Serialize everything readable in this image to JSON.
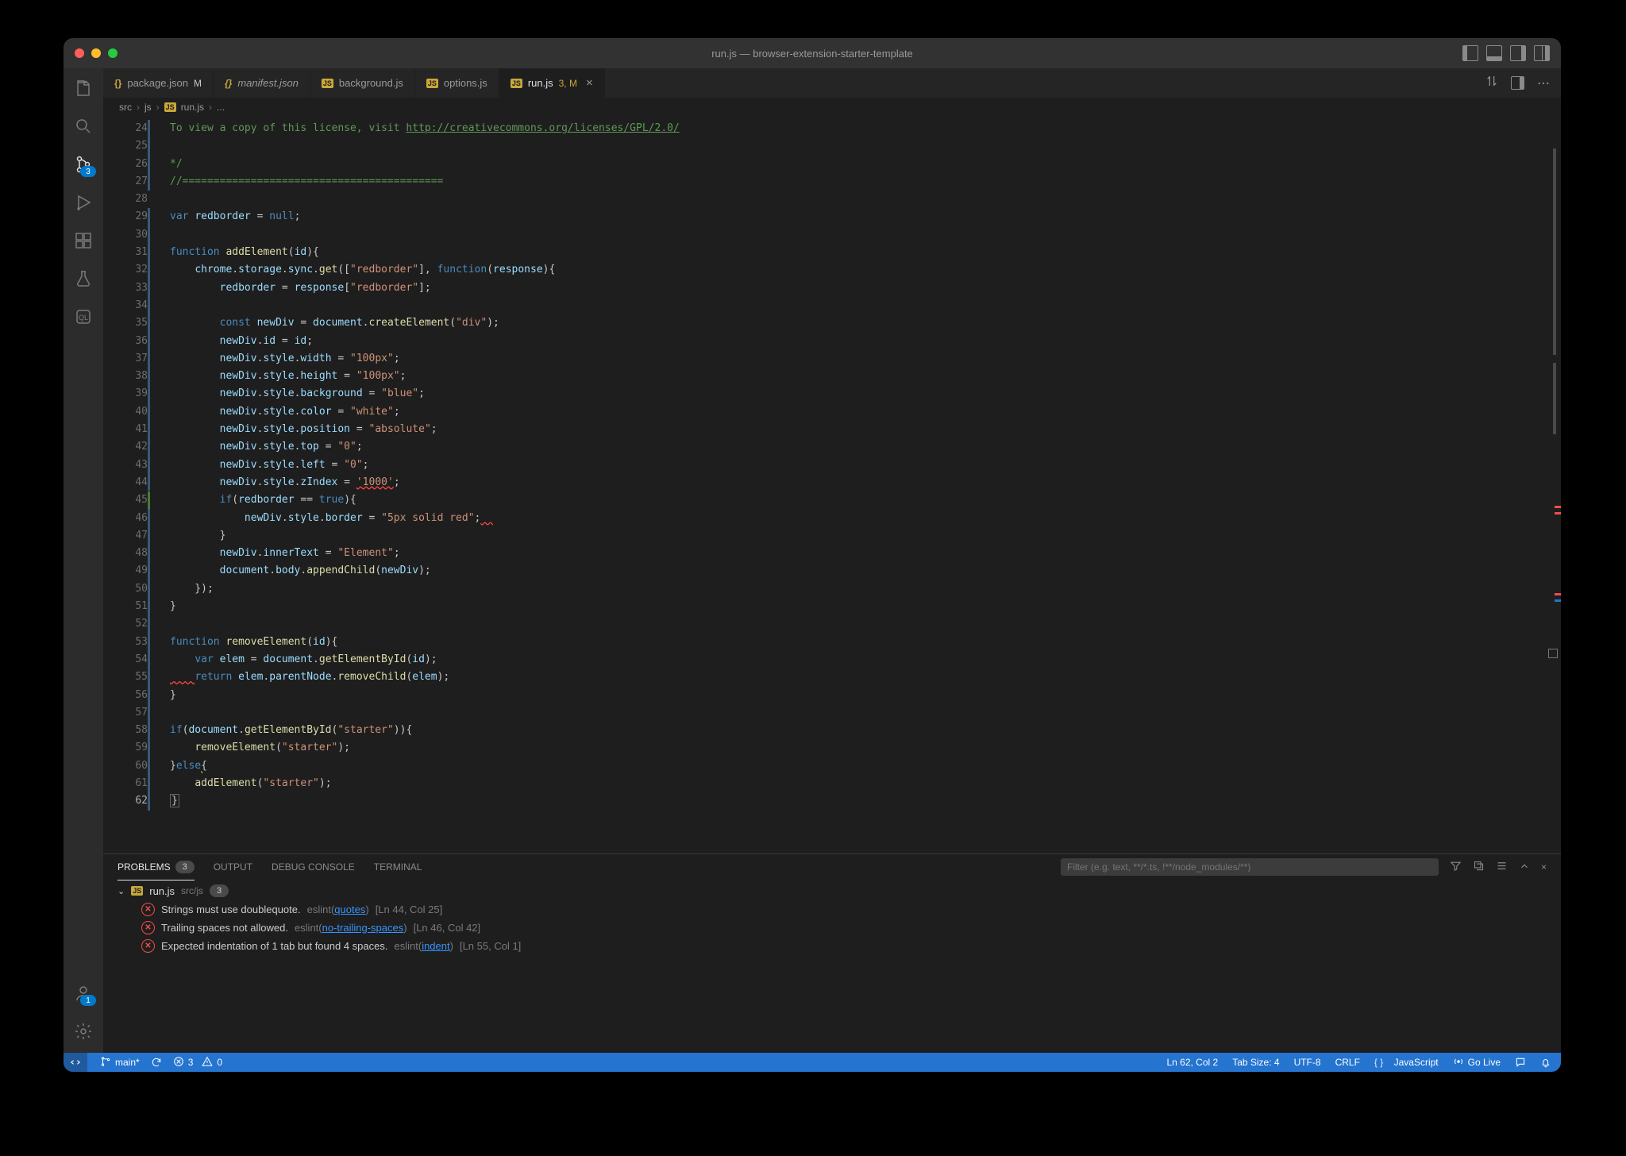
{
  "window": {
    "title": "run.js — browser-extension-starter-template"
  },
  "tabs": [
    {
      "icon": "json",
      "label": "package.json",
      "suffix": "M",
      "italic": false
    },
    {
      "icon": "json",
      "label": "manifest.json",
      "suffix": "",
      "italic": true
    },
    {
      "icon": "js",
      "label": "background.js",
      "suffix": "",
      "italic": false
    },
    {
      "icon": "js",
      "label": "options.js",
      "suffix": "",
      "italic": false
    },
    {
      "icon": "js",
      "label": "run.js",
      "suffix": "3, M",
      "italic": false,
      "active": true,
      "close": true
    }
  ],
  "breadcrumb": {
    "parts": [
      "src",
      "js",
      "run.js"
    ],
    "tail": "..."
  },
  "editor": {
    "first_line": 24,
    "active_line": 62,
    "lines": [
      {
        "n": 24,
        "html": "<span class='c-com'>To view a copy of this license, visit <span class='underline'>http://creativecommons.org/licenses/GPL/2.0/</span></span>"
      },
      {
        "n": 25,
        "html": ""
      },
      {
        "n": 26,
        "html": "<span class='c-com'>*/</span>"
      },
      {
        "n": 27,
        "html": "<span class='c-com'>//==========================================</span>"
      },
      {
        "n": 28,
        "html": ""
      },
      {
        "n": 29,
        "html": "<span class='c-key'>var</span> <span class='c-var'>redborder</span> = <span class='c-bool'>null</span>;"
      },
      {
        "n": 30,
        "html": ""
      },
      {
        "n": 31,
        "html": "<span class='c-key'>function</span> <span class='c-fn'>addElement</span>(<span class='c-var'>id</span>){"
      },
      {
        "n": 32,
        "html": "    <span class='c-var'>chrome</span>.<span class='c-var'>storage</span>.<span class='c-var'>sync</span>.<span class='c-fn'>get</span>([<span class='c-str'>\"redborder\"</span>], <span class='c-key'>function</span>(<span class='c-var'>response</span>){"
      },
      {
        "n": 33,
        "html": "        <span class='c-var'>redborder</span> = <span class='c-var'>response</span>[<span class='c-str'>\"redborder\"</span>];"
      },
      {
        "n": 34,
        "html": ""
      },
      {
        "n": 35,
        "html": "        <span class='c-key'>const</span> <span class='c-var'>newDiv</span> = <span class='c-var'>document</span>.<span class='c-fn'>createElement</span>(<span class='c-str'>\"div\"</span>);"
      },
      {
        "n": 36,
        "html": "        <span class='c-var'>newDiv</span>.<span class='c-var'>id</span> = <span class='c-var'>id</span>;"
      },
      {
        "n": 37,
        "html": "        <span class='c-var'>newDiv</span>.<span class='c-var'>style</span>.<span class='c-var'>width</span> = <span class='c-str'>\"100px\"</span>;"
      },
      {
        "n": 38,
        "html": "        <span class='c-var'>newDiv</span>.<span class='c-var'>style</span>.<span class='c-var'>height</span> = <span class='c-str'>\"100px\"</span>;"
      },
      {
        "n": 39,
        "html": "        <span class='c-var'>newDiv</span>.<span class='c-var'>style</span>.<span class='c-var'>background</span> = <span class='c-str'>\"blue\"</span>;"
      },
      {
        "n": 40,
        "html": "        <span class='c-var'>newDiv</span>.<span class='c-var'>style</span>.<span class='c-var'>color</span> = <span class='c-str'>\"white\"</span>;"
      },
      {
        "n": 41,
        "html": "        <span class='c-var'>newDiv</span>.<span class='c-var'>style</span>.<span class='c-var'>position</span> = <span class='c-str'>\"absolute\"</span>;"
      },
      {
        "n": 42,
        "html": "        <span class='c-var'>newDiv</span>.<span class='c-var'>style</span>.<span class='c-var'>top</span> = <span class='c-str'>\"0\"</span>;"
      },
      {
        "n": 43,
        "html": "        <span class='c-var'>newDiv</span>.<span class='c-var'>style</span>.<span class='c-var'>left</span> = <span class='c-str'>\"0\"</span>;"
      },
      {
        "n": 44,
        "html": "        <span class='c-var'>newDiv</span>.<span class='c-var'>style</span>.<span class='c-var'>zIndex</span> = <span class='c-str squiggle'>'1000'</span>;"
      },
      {
        "n": 45,
        "html": "        <span class='c-key'>if</span>(<span class='c-var'>redborder</span> == <span class='c-bool'>true</span>){"
      },
      {
        "n": 46,
        "html": "            <span class='c-var'>newDiv</span>.<span class='c-var'>style</span>.<span class='c-var'>border</span> = <span class='c-str'>\"5px solid red\"</span>;<span class='squiggle'>  </span>"
      },
      {
        "n": 47,
        "html": "        }"
      },
      {
        "n": 48,
        "html": "        <span class='c-var'>newDiv</span>.<span class='c-var'>innerText</span> = <span class='c-str'>\"Element\"</span>;"
      },
      {
        "n": 49,
        "html": "        <span class='c-var'>document</span>.<span class='c-var'>body</span>.<span class='c-fn'>appendChild</span>(<span class='c-var'>newDiv</span>);"
      },
      {
        "n": 50,
        "html": "    });"
      },
      {
        "n": 51,
        "html": "}"
      },
      {
        "n": 52,
        "html": ""
      },
      {
        "n": 53,
        "html": "<span class='c-key'>function</span> <span class='c-fn'>removeElement</span>(<span class='c-var'>id</span>){"
      },
      {
        "n": 54,
        "html": "    <span class='c-key'>var</span> <span class='c-var'>elem</span> = <span class='c-var'>document</span>.<span class='c-fn'>getElementById</span>(<span class='c-var'>id</span>);"
      },
      {
        "n": 55,
        "html": "<span class='squiggle'>    </span><span class='c-key'>return</span> <span class='c-var'>elem</span>.<span class='c-var'>parentNode</span>.<span class='c-fn'>removeChild</span>(<span class='c-var'>elem</span>);"
      },
      {
        "n": 56,
        "html": "}"
      },
      {
        "n": 57,
        "html": ""
      },
      {
        "n": 58,
        "html": "<span class='c-key'>if</span>(<span class='c-var'>document</span>.<span class='c-fn'>getElementById</span>(<span class='c-str'>\"starter\"</span>)){"
      },
      {
        "n": 59,
        "html": "    <span class='c-fn'>removeElement</span>(<span class='c-str'>\"starter\"</span>);"
      },
      {
        "n": 60,
        "html": "}<span class='c-key'>else</span><span class='squiggle-y'>{</span>"
      },
      {
        "n": 61,
        "html": "    <span class='c-fn'>addElement</span>(<span class='c-str'>\"starter\"</span>);"
      },
      {
        "n": 62,
        "html": "<span style='border:1px solid #666;padding:0 1px'>}</span>"
      }
    ]
  },
  "panel": {
    "tabs": {
      "problems": "PROBLEMS",
      "output": "OUTPUT",
      "debug": "DEBUG CONSOLE",
      "terminal": "TERMINAL"
    },
    "problem_count": "3",
    "filter_placeholder": "Filter (e.g. text, **/*.ts, !**/node_modules/**)",
    "file": {
      "name": "run.js",
      "path": "src/js",
      "count": "3"
    },
    "items": [
      {
        "msg": "Strings must use doublequote.",
        "src": "eslint",
        "rule": "quotes",
        "loc": "[Ln 44, Col 25]"
      },
      {
        "msg": "Trailing spaces not allowed.",
        "src": "eslint",
        "rule": "no-trailing-spaces",
        "loc": "[Ln 46, Col 42]"
      },
      {
        "msg": "Expected indentation of 1 tab but found 4 spaces.",
        "src": "eslint",
        "rule": "indent",
        "loc": "[Ln 55, Col 1]"
      }
    ]
  },
  "statusbar": {
    "branch": "main*",
    "errors": "3",
    "warnings": "0",
    "cursor": "Ln 62, Col 2",
    "tab_size": "Tab Size: 4",
    "encoding": "UTF-8",
    "eol": "CRLF",
    "language": "JavaScript",
    "go_live": "Go Live"
  },
  "activity": {
    "scm_badge": "3",
    "account_badge": "1"
  }
}
